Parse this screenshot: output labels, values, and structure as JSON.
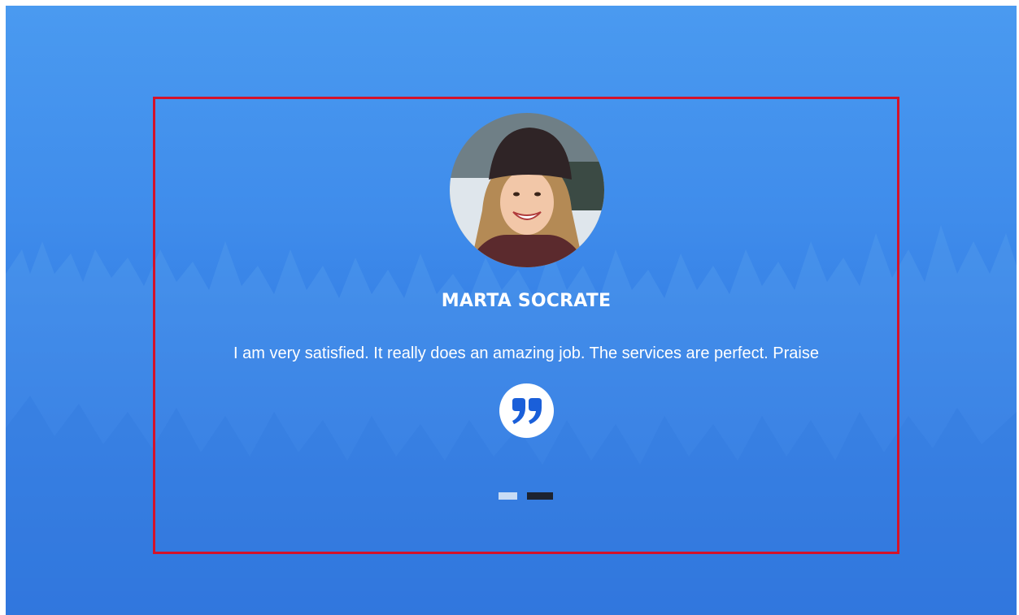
{
  "testimonial": {
    "name": "MARTA SOCRATE",
    "text": "I am very satisfied. It really does an amazing job. The services are perfect. Praise",
    "avatar_icon": "person-photo",
    "quote_icon": "quote-icon"
  },
  "slider": {
    "slide_count": 2,
    "active_index": 1
  },
  "colors": {
    "background_top": "#4a9af0",
    "background_bottom": "#1f63d6",
    "card_border": "#d4122a",
    "quote_color": "#1a5fd9",
    "dot_inactive": "#c9dcf5",
    "dot_active": "#1d2330"
  }
}
